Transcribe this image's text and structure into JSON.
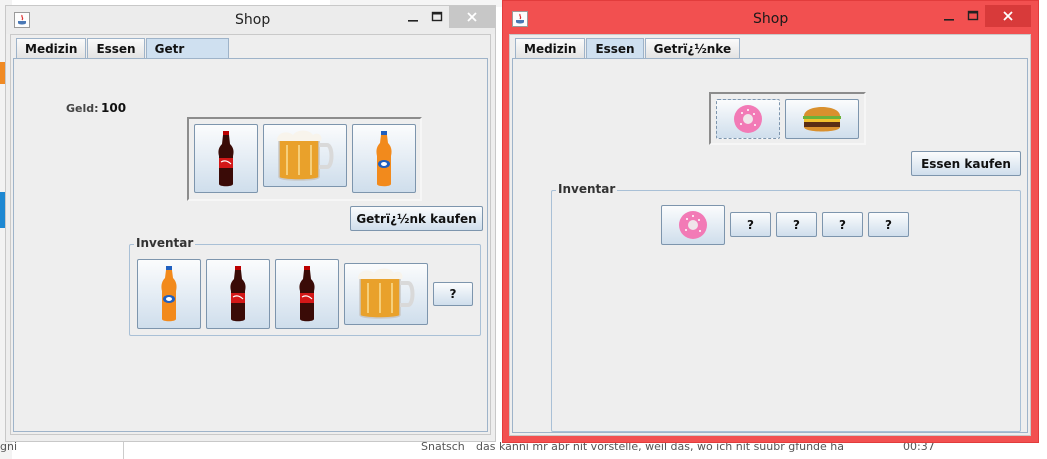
{
  "background": {
    "bottom_texts": [
      "gni",
      "Snatsch",
      "das kanni mr abr nit vorstelle, weil das, wo ich nit suubr gfunde ha",
      "00:37"
    ]
  },
  "left_window": {
    "title": "Shop",
    "tabs": [
      {
        "label": "Medizin",
        "active": false
      },
      {
        "label": "Essen",
        "active": false
      },
      {
        "label": "Getr",
        "active": true
      }
    ],
    "money_label": "Geld:",
    "money_value": "100",
    "products": [
      "cola-bottle",
      "beer-mug",
      "orange-soda-bottle"
    ],
    "buy_button": "Getrï¿½nk kaufen",
    "inventory_title": "Inventar",
    "inventory": [
      "orange-soda-bottle",
      "cola-bottle",
      "cola-bottle",
      "beer-mug"
    ],
    "empty_slot_label": "?"
  },
  "right_window": {
    "title": "Shop",
    "tabs": [
      {
        "label": "Medizin",
        "active": false
      },
      {
        "label": "Essen",
        "active": true
      },
      {
        "label": "Getrï¿½nke",
        "active": false
      }
    ],
    "products": [
      "donut",
      "burger"
    ],
    "buy_button": "Essen kaufen",
    "inventory_title": "Inventar",
    "inventory": [
      "donut"
    ],
    "empty_slot_label": "?"
  },
  "colors": {
    "active_window_border": "#f25050",
    "button_gradient_bottom": "#cfdeec"
  }
}
